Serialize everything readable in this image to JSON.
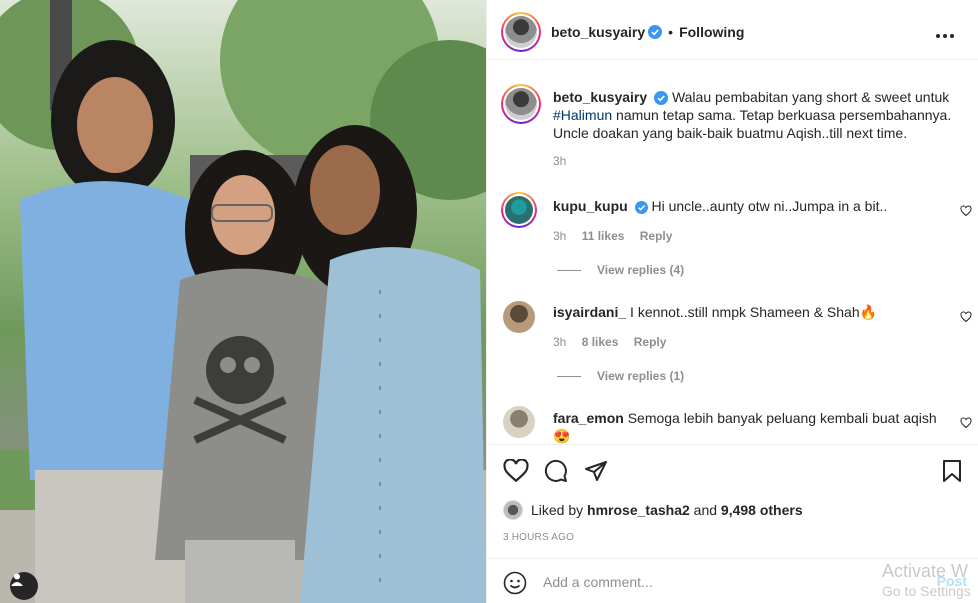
{
  "header": {
    "username": "beto_kusyairy",
    "separator": "•",
    "follow_status": "Following"
  },
  "caption": {
    "username": "beto_kusyairy",
    "text_before": "Walau pembabitan yang short & sweet untuk",
    "hashtag": "#Halimun",
    "text_after": "namun tetap sama. Tetap berkuasa persembahannya. Uncle doakan yang baik-baik buatmu Aqish..till next time.",
    "time": "3h"
  },
  "comments": [
    {
      "username": "kupu_kupu",
      "verified": true,
      "text": "Hi uncle..aunty otw ni..Jumpa in a bit..",
      "time": "3h",
      "likes": "11 likes",
      "reply": "Reply",
      "view_replies": "View replies (4)"
    },
    {
      "username": "isyairdani_",
      "verified": false,
      "text": "I kennot..still nmpk Shameen & Shah🔥",
      "time": "3h",
      "likes": "8 likes",
      "reply": "Reply",
      "view_replies": "View replies (1)"
    },
    {
      "username": "fara_emon",
      "verified": false,
      "text": "Semoga lebih banyak peluang kembali buat aqish 😍"
    }
  ],
  "likes_line": {
    "prefix": "Liked by",
    "user": "hmrose_tasha2",
    "middle": "and",
    "others": "9,498 others"
  },
  "posted_time": "3 HOURS AGO",
  "add_comment": {
    "placeholder": "Add a comment...",
    "post_label": "Post"
  },
  "watermark": {
    "line1": "Activate W",
    "line2": "Go to Settings"
  },
  "icons": {
    "verified": "verified-badge-icon",
    "more": "more-options-icon",
    "like": "heart-icon",
    "comment": "comment-icon",
    "share": "paper-plane-icon",
    "save": "bookmark-icon",
    "emoji": "smiley-icon",
    "tag": "user-tag-icon"
  },
  "colors": {
    "verified_blue": "#3897f0",
    "hashtag": "#00376b",
    "muted": "#8e8e8e",
    "post_disabled": "#b2dffc"
  }
}
